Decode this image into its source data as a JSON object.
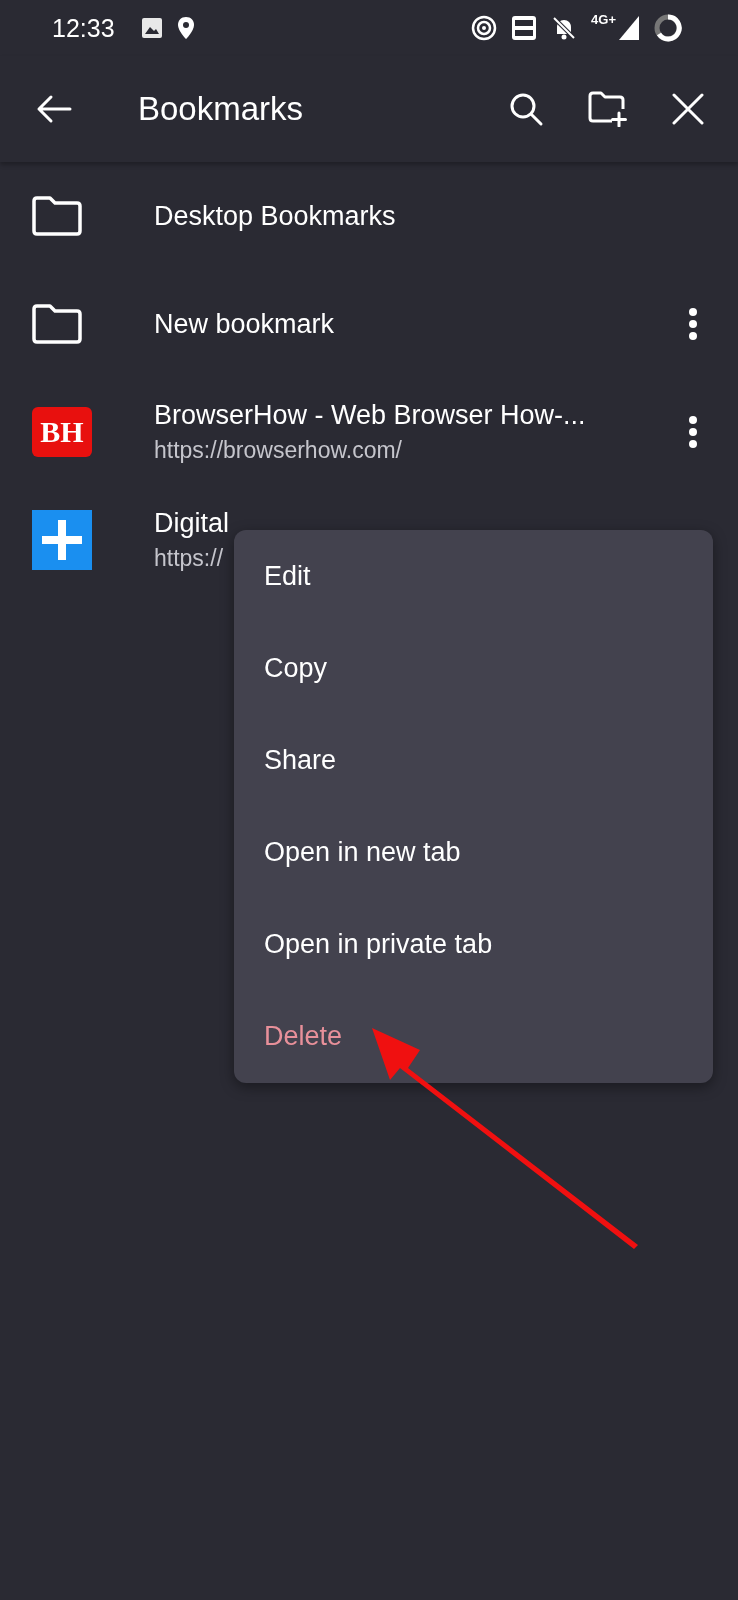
{
  "status_bar": {
    "time": "12:33",
    "network": "4G+"
  },
  "toolbar": {
    "title": "Bookmarks"
  },
  "items": [
    {
      "kind": "folder",
      "title": "Desktop Bookmarks",
      "more_button": false
    },
    {
      "kind": "folder",
      "title": "New bookmark",
      "more_button": true
    },
    {
      "kind": "text-logo",
      "logo_text": "BH",
      "title": "BrowserHow - Web Browser How-...",
      "url": "https://browserhow.com/",
      "more_button": true
    },
    {
      "kind": "plus-logo",
      "title": "Digital",
      "url": "https://",
      "more_button": false
    }
  ],
  "context_menu": {
    "items": [
      {
        "label": "Edit",
        "kind": "normal"
      },
      {
        "label": "Copy",
        "kind": "normal"
      },
      {
        "label": "Share",
        "kind": "normal"
      },
      {
        "label": "Open in new tab",
        "kind": "normal"
      },
      {
        "label": "Open in private tab",
        "kind": "normal"
      },
      {
        "label": "Delete",
        "kind": "danger"
      }
    ]
  }
}
